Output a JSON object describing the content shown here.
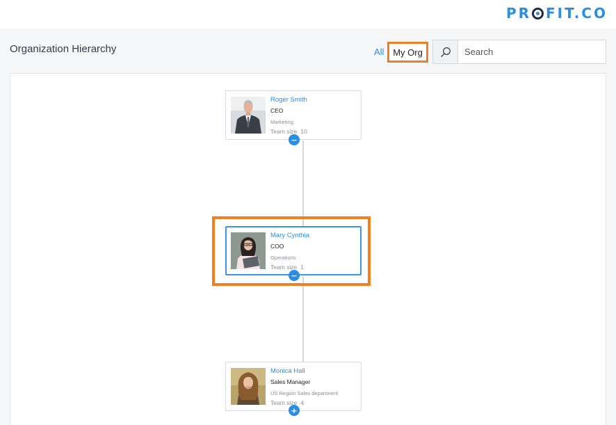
{
  "brand": {
    "logo_left": "PR",
    "logo_right": "FIT.CO",
    "color": "#2b8ee6"
  },
  "header": {
    "title": "Organization Hierarchy"
  },
  "filters": {
    "all_label": "All",
    "myorg_label": "My Org",
    "active": "My Org"
  },
  "search": {
    "placeholder": "Search",
    "value": ""
  },
  "hierarchy": {
    "nodes": [
      {
        "name": "Roger Smith",
        "title": "CEO",
        "department": "Marketing",
        "team_label": "Team size",
        "team_size": "10",
        "toggle": "−",
        "selected": false
      },
      {
        "name": "Mary Cynthia",
        "title": "COO",
        "department": "Operations",
        "team_label": "Team size",
        "team_size": "1",
        "toggle": "−",
        "selected": true
      },
      {
        "name": "Monica Hall",
        "title": "Sales Manager",
        "department": "US Region Sales department",
        "team_label": "Team size",
        "team_size": "4",
        "toggle": "+",
        "selected": false
      }
    ]
  },
  "colors": {
    "accent": "#2b8ee6",
    "highlight": "#f07f22",
    "selected_border": "#3a93e8"
  }
}
